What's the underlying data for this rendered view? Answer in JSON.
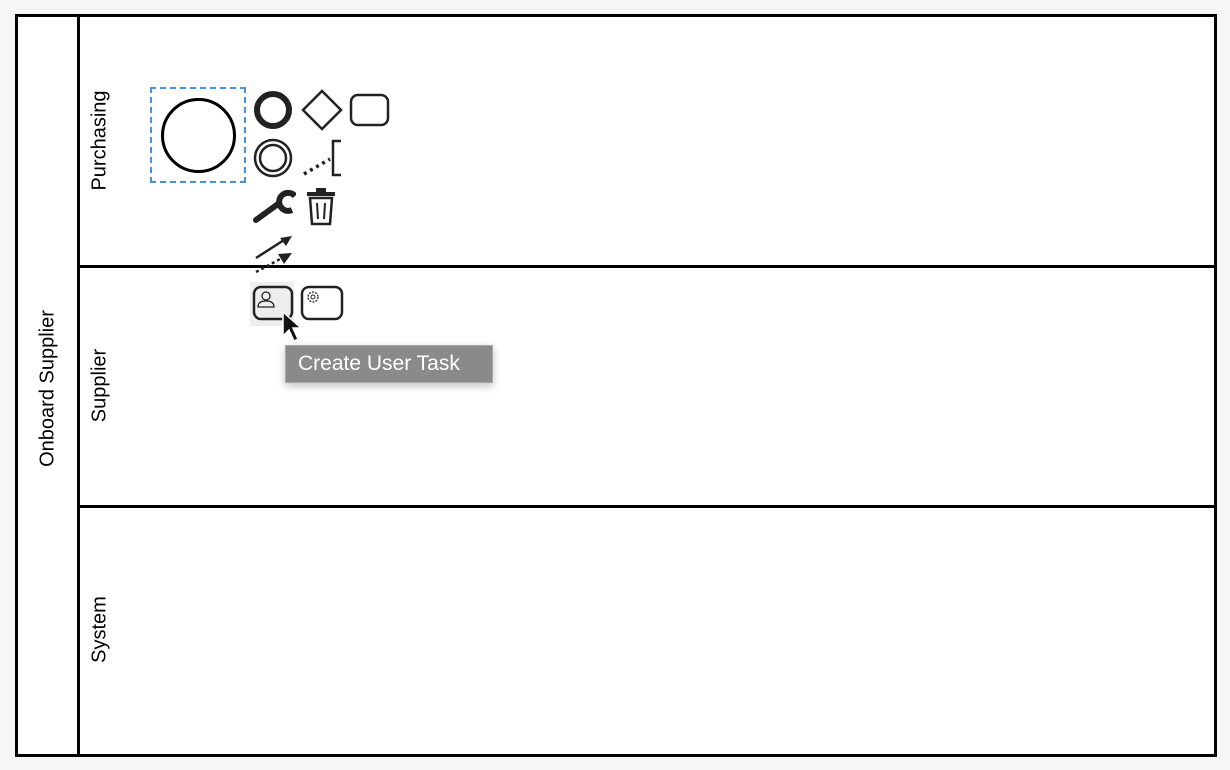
{
  "pool": {
    "label": "Onboard Supplier"
  },
  "lanes": [
    {
      "label": "Purchasing"
    },
    {
      "label": "Supplier"
    },
    {
      "label": "System"
    }
  ],
  "selected_element": {
    "type": "start-event",
    "selected": true
  },
  "context_pad": {
    "items": [
      {
        "name": "append-end-event",
        "icon": "end-event-icon"
      },
      {
        "name": "append-gateway",
        "icon": "gateway-icon"
      },
      {
        "name": "append-task",
        "icon": "task-icon"
      },
      {
        "name": "append-intermediate-event",
        "icon": "intermediate-event-icon"
      },
      {
        "name": "append-text-annotation",
        "icon": "text-annotation-icon"
      },
      {
        "name": "change-type",
        "icon": "wrench-icon"
      },
      {
        "name": "delete",
        "icon": "trash-icon"
      },
      {
        "name": "connect",
        "icon": "connect-arrows-icon"
      },
      {
        "name": "append-user-task",
        "icon": "user-task-icon"
      },
      {
        "name": "append-service-task",
        "icon": "service-task-icon"
      }
    ]
  },
  "tooltip": {
    "text": "Create User Task"
  },
  "colors": {
    "selection": "#4a90e2",
    "tooltip_bg": "#8a8a8a",
    "border": "#000000"
  }
}
